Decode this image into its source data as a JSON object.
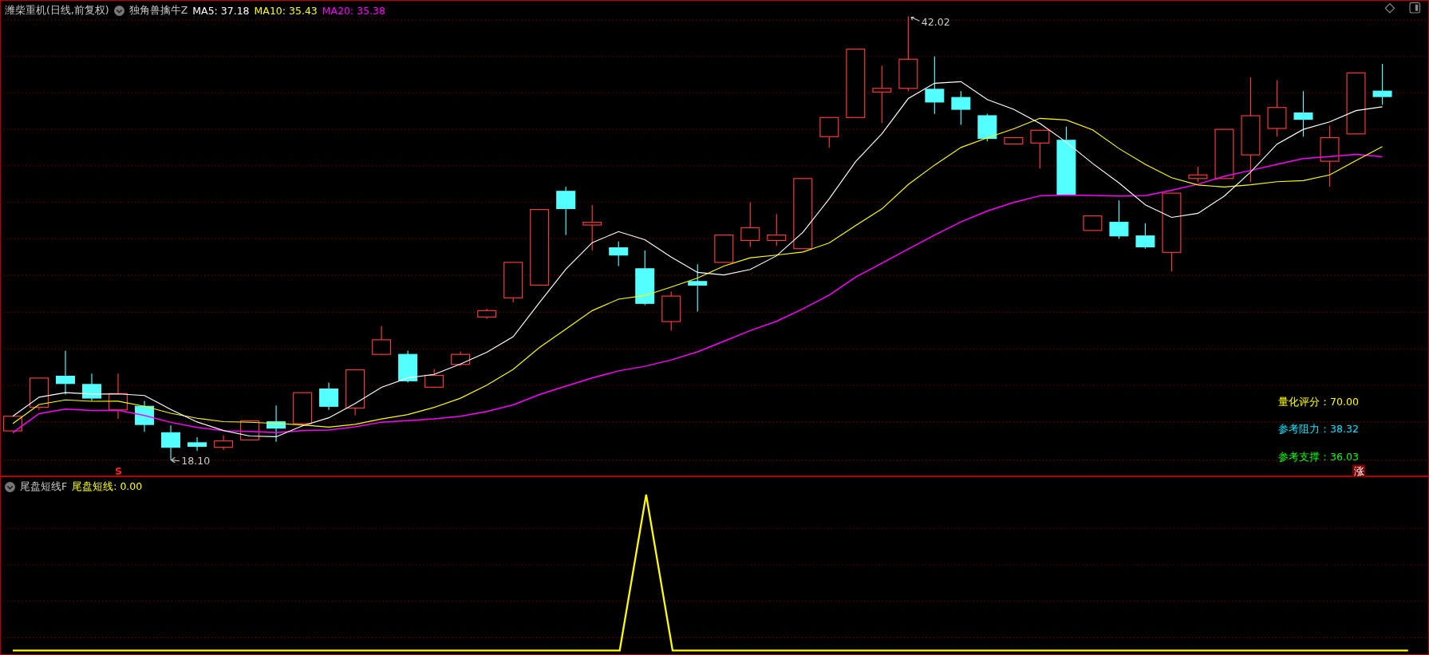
{
  "main_panel": {
    "stock_title": "潍柴重机(日线,前复权)",
    "indicator_name": "独角兽擒牛Z",
    "ma_readings": [
      {
        "label": "MA5: 37.18",
        "color": "#ffffff"
      },
      {
        "label": "MA10: 35.43",
        "color": "#ffff00"
      },
      {
        "label": "MA20: 35.38",
        "color": "#ff00ff"
      }
    ],
    "high_marker": "42.02",
    "low_marker": "18.10",
    "signal_marker": "S",
    "stats": [
      {
        "text": "量化评分：70.00",
        "color": "#ffff00"
      },
      {
        "text": "参考阻力：38.32",
        "color": "#00e5ff"
      },
      {
        "text": "参考支撑：36.03",
        "color": "#00ff00"
      }
    ],
    "rise_badge": "涨"
  },
  "sub_panel": {
    "indicator_name": "尾盘短线F",
    "reading": "尾盘短线: 0.00"
  }
}
